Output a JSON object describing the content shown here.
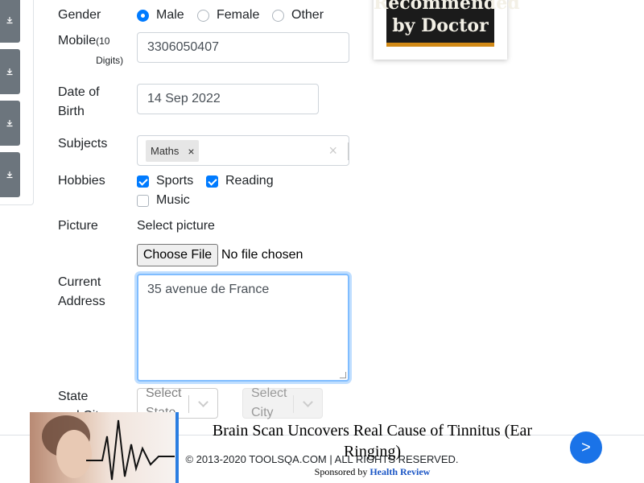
{
  "form": {
    "gender": {
      "label": "Gender",
      "options": [
        "Male",
        "Female",
        "Other"
      ],
      "selected": "Male"
    },
    "mobile": {
      "label": "Mobile",
      "hint": "(10 Digits)",
      "value": "3306050407"
    },
    "dob": {
      "label_line1": "Date of",
      "label_line2": "Birth",
      "value": "14 Sep 2022"
    },
    "subjects": {
      "label": "Subjects",
      "tags": [
        "Maths"
      ],
      "clear_symbol": "×",
      "remove_symbol": "×"
    },
    "hobbies": {
      "label": "Hobbies",
      "options": [
        {
          "label": "Sports",
          "checked": true
        },
        {
          "label": "Reading",
          "checked": true
        },
        {
          "label": "Music",
          "checked": false
        }
      ]
    },
    "picture": {
      "label": "Picture",
      "caption": "Select picture",
      "button": "Choose File",
      "file_status": "No file chosen"
    },
    "address": {
      "label_line1": "Current",
      "label_line2": "Address",
      "value": "35 avenue de France"
    },
    "state_city": {
      "label_line1": "State",
      "label_line2": "and City",
      "state_placeholder_line1": "Select",
      "state_placeholder_line2": "State",
      "city_placeholder_line1": "Select",
      "city_placeholder_line2": "City"
    }
  },
  "sidebar": {
    "buttons": [
      "download-icon",
      "download-icon",
      "download-icon",
      "download-icon"
    ],
    "button_color": "#6c757d"
  },
  "ad_top": {
    "line1": "Recommended",
    "line2": "by Doctor"
  },
  "footer": {
    "copyright": "© 2013-2020 TOOLSQA.COM | ALL RIGHTS RESERVED."
  },
  "ad_bottom": {
    "headline": "Brain Scan Uncovers Real Cause of Tinnitus (Ear Ringing)",
    "sponsor_prefix": "Sponsored by",
    "sponsor_brand": "Health Review",
    "next_symbol": ">",
    "accent_color": "#1a73e8"
  },
  "colors": {
    "primary": "#007bff",
    "focus_border": "#80bdff"
  }
}
